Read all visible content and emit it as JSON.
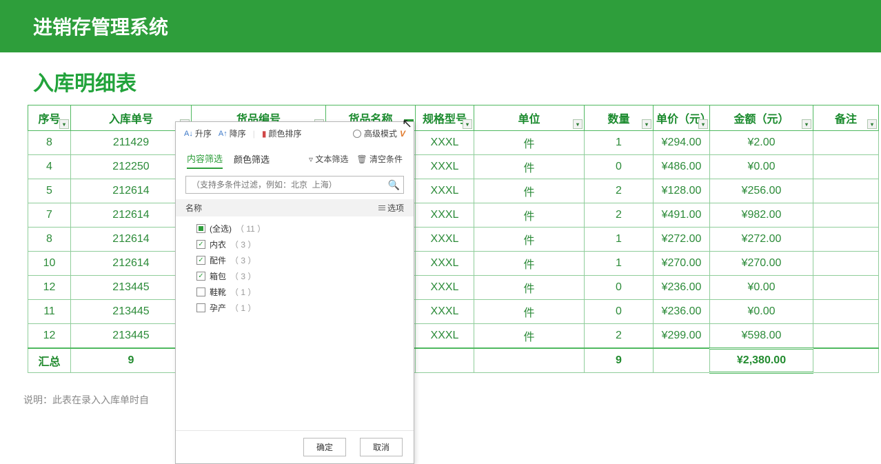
{
  "header": {
    "system_title": "进销存管理系统",
    "page_title": "入库明细表"
  },
  "columns": {
    "seq": "序号",
    "order_no": "入库单号",
    "part_no": "货品编号",
    "name": "货品名称",
    "spec": "规格型号",
    "unit": "单位",
    "qty": "数量",
    "unit_price": "单价（元）",
    "amount": "金额（元）",
    "note": "备注"
  },
  "rows": [
    {
      "seq": "8",
      "order_no": "211429",
      "spec": "XXXL",
      "unit": "件",
      "qty": "1",
      "price": "¥294.00",
      "amount": "¥2.00"
    },
    {
      "seq": "4",
      "order_no": "212250",
      "spec": "XXXL",
      "unit": "件",
      "qty": "0",
      "price": "¥486.00",
      "amount": "¥0.00"
    },
    {
      "seq": "5",
      "order_no": "212614",
      "spec": "XXXL",
      "unit": "件",
      "qty": "2",
      "price": "¥128.00",
      "amount": "¥256.00"
    },
    {
      "seq": "7",
      "order_no": "212614",
      "spec": "XXXL",
      "unit": "件",
      "qty": "2",
      "price": "¥491.00",
      "amount": "¥982.00"
    },
    {
      "seq": "8",
      "order_no": "212614",
      "spec": "XXXL",
      "unit": "件",
      "qty": "1",
      "price": "¥272.00",
      "amount": "¥272.00"
    },
    {
      "seq": "10",
      "order_no": "212614",
      "spec": "XXXL",
      "unit": "件",
      "qty": "1",
      "price": "¥270.00",
      "amount": "¥270.00"
    },
    {
      "seq": "12",
      "order_no": "213445",
      "spec": "XXXL",
      "unit": "件",
      "qty": "0",
      "price": "¥236.00",
      "amount": "¥0.00"
    },
    {
      "seq": "11",
      "order_no": "213445",
      "spec": "XXXL",
      "unit": "件",
      "qty": "0",
      "price": "¥236.00",
      "amount": "¥0.00"
    },
    {
      "seq": "12",
      "order_no": "213445",
      "spec": "XXXL",
      "unit": "件",
      "qty": "2",
      "price": "¥299.00",
      "amount": "¥598.00"
    }
  ],
  "summary": {
    "label": "汇总",
    "order_count": "9",
    "qty_total": "9",
    "amount_total": "¥2,380.00"
  },
  "footer_note": "说明：此表在录入入库单时自",
  "filter_panel": {
    "sort_asc": "升序",
    "sort_desc": "降序",
    "color_sort": "颜色排序",
    "adv_mode": "高级模式",
    "tab_content": "内容筛选",
    "tab_color": "颜色筛选",
    "text_filter": "文本筛选",
    "clear_cond": "清空条件",
    "search_placeholder": "（支持多条件过滤，例如：北京  上海）",
    "name_col": "名称",
    "options_label": "选项",
    "all_label": "(全选)",
    "all_count": "（ 11 ）",
    "items": [
      {
        "label": "内衣",
        "count": "（ 3 ）",
        "checked": true
      },
      {
        "label": "配件",
        "count": "（ 3 ）",
        "checked": true
      },
      {
        "label": "箱包",
        "count": "（ 3 ）",
        "checked": true
      },
      {
        "label": "鞋靴",
        "count": "（ 1 ）",
        "checked": false
      },
      {
        "label": "孕产",
        "count": "（ 1 ）",
        "checked": false
      }
    ],
    "ok": "确定",
    "cancel": "取消"
  }
}
